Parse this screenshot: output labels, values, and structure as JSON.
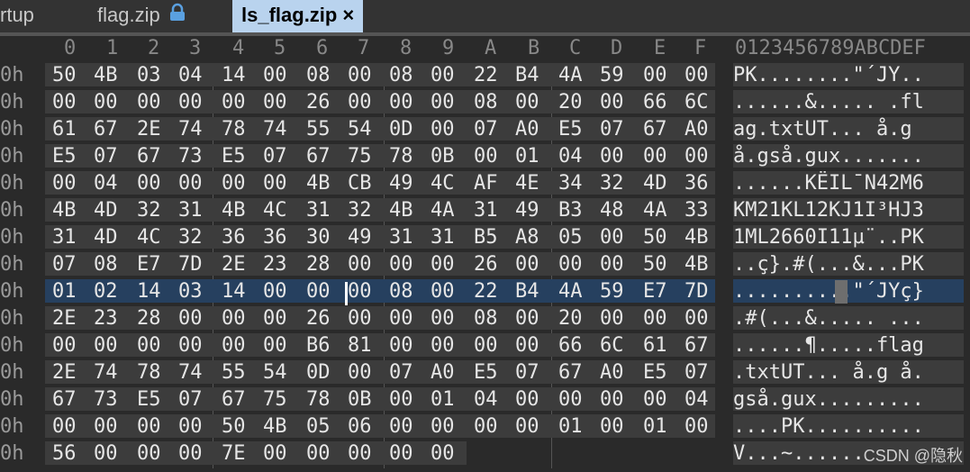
{
  "tabs": [
    {
      "label": "rtup",
      "active": false
    },
    {
      "label": "flag.zip",
      "active": false,
      "icon": "lock-icon"
    },
    {
      "label": "ls_flag.zip",
      "active": true,
      "close": "×"
    }
  ],
  "columns": [
    "0",
    "1",
    "2",
    "3",
    "4",
    "5",
    "6",
    "7",
    "8",
    "9",
    "A",
    "B",
    "C",
    "D",
    "E",
    "F"
  ],
  "ascii_header": "0123456789ABCDEF",
  "selected_row": 8,
  "rows": [
    {
      "offset": "0h",
      "hex": [
        "50",
        "4B",
        "03",
        "04",
        "14",
        "00",
        "08",
        "00",
        "08",
        "00",
        "22",
        "B4",
        "4A",
        "59",
        "00",
        "00"
      ],
      "ascii": "PK........\"´JY.."
    },
    {
      "offset": "0h",
      "hex": [
        "00",
        "00",
        "00",
        "00",
        "00",
        "00",
        "26",
        "00",
        "00",
        "00",
        "08",
        "00",
        "20",
        "00",
        "66",
        "6C"
      ],
      "ascii": "......&..... .fl"
    },
    {
      "offset": "0h",
      "hex": [
        "61",
        "67",
        "2E",
        "74",
        "78",
        "74",
        "55",
        "54",
        "0D",
        "00",
        "07",
        "A0",
        "E5",
        "07",
        "67",
        "A0"
      ],
      "ascii": "ag.txtUT... å.g "
    },
    {
      "offset": "0h",
      "hex": [
        "E5",
        "07",
        "67",
        "73",
        "E5",
        "07",
        "67",
        "75",
        "78",
        "0B",
        "00",
        "01",
        "04",
        "00",
        "00",
        "00"
      ],
      "ascii": "å.gså.gux......."
    },
    {
      "offset": "0h",
      "hex": [
        "00",
        "04",
        "00",
        "00",
        "00",
        "00",
        "4B",
        "CB",
        "49",
        "4C",
        "AF",
        "4E",
        "34",
        "32",
        "4D",
        "36"
      ],
      "ascii": "......KËIL¯N42M6"
    },
    {
      "offset": "0h",
      "hex": [
        "4B",
        "4D",
        "32",
        "31",
        "4B",
        "4C",
        "31",
        "32",
        "4B",
        "4A",
        "31",
        "49",
        "B3",
        "48",
        "4A",
        "33"
      ],
      "ascii": "KM21KL12KJ1I³HJ3"
    },
    {
      "offset": "0h",
      "hex": [
        "31",
        "4D",
        "4C",
        "32",
        "36",
        "36",
        "30",
        "49",
        "31",
        "31",
        "B5",
        "A8",
        "05",
        "00",
        "50",
        "4B"
      ],
      "ascii": "1ML2660I11µ¨..PK"
    },
    {
      "offset": "0h",
      "hex": [
        "07",
        "08",
        "E7",
        "7D",
        "2E",
        "23",
        "28",
        "00",
        "00",
        "00",
        "26",
        "00",
        "00",
        "00",
        "50",
        "4B"
      ],
      "ascii": "..ç}.#(...&...PK"
    },
    {
      "offset": "0h",
      "hex": [
        "01",
        "02",
        "14",
        "03",
        "14",
        "00",
        "00",
        "00",
        "08",
        "00",
        "22",
        "B4",
        "4A",
        "59",
        "E7",
        "7D"
      ],
      "ascii": "..........\"´JYç}"
    },
    {
      "offset": "0h",
      "hex": [
        "2E",
        "23",
        "28",
        "00",
        "00",
        "00",
        "26",
        "00",
        "00",
        "00",
        "08",
        "00",
        "20",
        "00",
        "00",
        "00"
      ],
      "ascii": ".#(...&..... ..."
    },
    {
      "offset": "0h",
      "hex": [
        "00",
        "00",
        "00",
        "00",
        "00",
        "00",
        "B6",
        "81",
        "00",
        "00",
        "00",
        "00",
        "66",
        "6C",
        "61",
        "67"
      ],
      "ascii": "......¶.....flag"
    },
    {
      "offset": "0h",
      "hex": [
        "2E",
        "74",
        "78",
        "74",
        "55",
        "54",
        "0D",
        "00",
        "07",
        "A0",
        "E5",
        "07",
        "67",
        "A0",
        "E5",
        "07"
      ],
      "ascii": ".txtUT... å.g å."
    },
    {
      "offset": "0h",
      "hex": [
        "67",
        "73",
        "E5",
        "07",
        "67",
        "75",
        "78",
        "0B",
        "00",
        "01",
        "04",
        "00",
        "00",
        "00",
        "00",
        "04"
      ],
      "ascii": "gså.gux........."
    },
    {
      "offset": "0h",
      "hex": [
        "00",
        "00",
        "00",
        "00",
        "50",
        "4B",
        "05",
        "06",
        "00",
        "00",
        "00",
        "00",
        "01",
        "00",
        "01",
        "00"
      ],
      "ascii": "....PK.........."
    },
    {
      "offset": "0h",
      "hex": [
        "56",
        "00",
        "00",
        "00",
        "7E",
        "00",
        "00",
        "00",
        "00",
        "00"
      ],
      "ascii": "V...~......"
    }
  ],
  "watermark": "CSDN @隐秋"
}
